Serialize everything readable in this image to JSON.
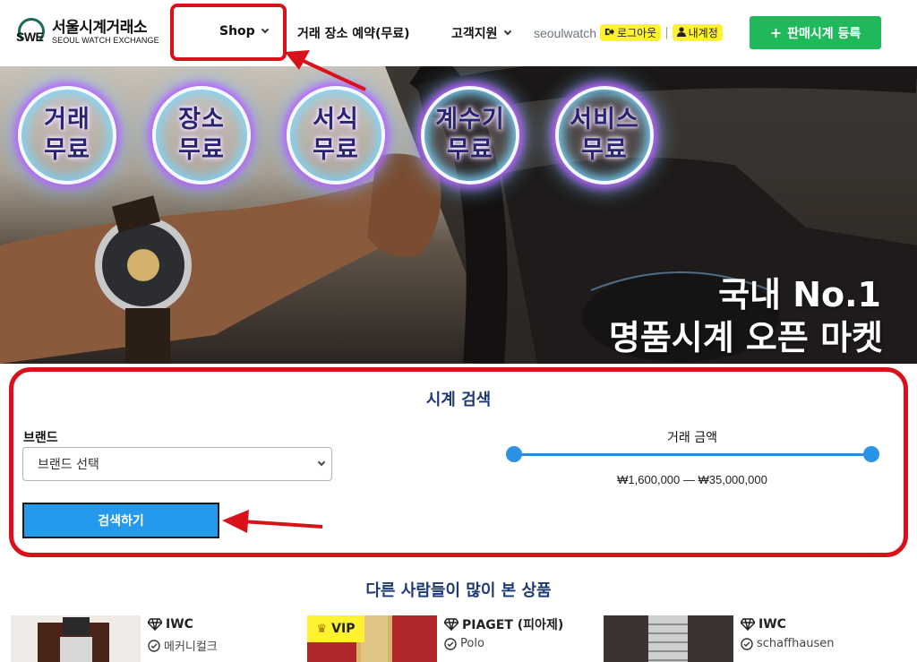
{
  "header": {
    "logo": {
      "name_ko": "서울시계거래소",
      "name_en": "SEOUL WATCH EXCHANGE",
      "mark": "SWE"
    },
    "nav": [
      {
        "label": "Shop",
        "has_dropdown": true
      },
      {
        "label": "거래 장소 예약(무료)",
        "has_dropdown": false
      },
      {
        "label": "고객지원",
        "has_dropdown": true
      }
    ],
    "username": "seoulwatch",
    "logout_label": "로그아웃",
    "separator": "|",
    "account_label": "내계정",
    "sell_button": "판매시계 등록"
  },
  "hero": {
    "badges": [
      {
        "line1": "거래",
        "line2": "무료"
      },
      {
        "line1": "장소",
        "line2": "무료"
      },
      {
        "line1": "서식",
        "line2": "무료"
      },
      {
        "line1": "계수기",
        "line2": "무료"
      },
      {
        "line1": "서비스",
        "line2": "무료"
      }
    ],
    "headline1": "국내 No.1",
    "headline2": "명품시계 오픈 마켓"
  },
  "search": {
    "title": "시계 검색",
    "brand_label": "브랜드",
    "brand_select_value": "브랜드 선택",
    "price_label": "거래 금액",
    "price_min": 1600000,
    "price_max": 35000000,
    "price_range_text": "₩1,600,000 — ₩35,000,000",
    "submit_label": "검색하기"
  },
  "popular": {
    "title": "다른 사람들이 많이 본 상품",
    "items": [
      {
        "brand": "IWC",
        "model": "메커니컬크",
        "sub": "",
        "price": "",
        "vip": false
      },
      {
        "brand": "PIAGET (피아제)",
        "model": "Polo",
        "sub": "",
        "price": "",
        "vip": true,
        "vip_label": "VIP"
      },
      {
        "brand": "IWC",
        "model": "schaffhausen",
        "sub": "",
        "price": "",
        "vip": false
      }
    ]
  },
  "colors": {
    "brand_green": "#1fb95c",
    "highlight_yellow": "#fff231",
    "title_navy": "#1e3a75",
    "search_button": "#259aed",
    "annotation_red": "#d9121a"
  }
}
